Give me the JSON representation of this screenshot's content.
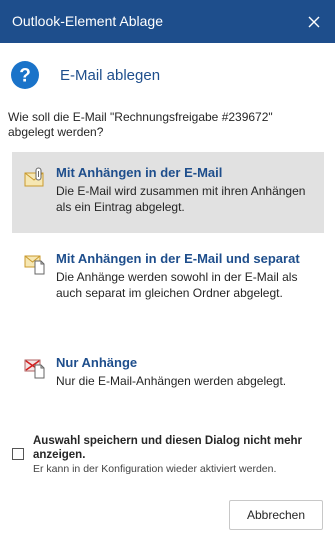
{
  "window": {
    "title": "Outlook-Element Ablage",
    "close_icon": "close-icon"
  },
  "header": {
    "icon": "question-icon",
    "title": "E-Mail ablegen"
  },
  "question": "Wie soll die E-Mail \"Rechnungsfreigabe #239672\" abgelegt werden?",
  "options": [
    {
      "icon": "mail-attachment-icon",
      "title": "Mit Anhängen in der E-Mail",
      "description": "Die E-Mail wird zusammen mit ihren Anhängen als ein Eintrag abgelegt.",
      "selected": true
    },
    {
      "icon": "mail-separate-attachments-icon",
      "title": "Mit Anhängen in der E-Mail und separat",
      "description": "Die Anhänge werden sowohl in der E-Mail als auch separat im gleichen Ordner abgelegt.",
      "selected": false
    },
    {
      "icon": "attachments-only-icon",
      "title": "Nur Anhänge",
      "description": "Nur die E-Mail-Anhängen werden abgelegt.",
      "selected": false
    }
  ],
  "remember": {
    "label": "Auswahl speichern und diesen Dialog nicht mehr anzeigen.",
    "hint": "Er kann in der Konfiguration wieder aktiviert werden.",
    "checked": false
  },
  "buttons": {
    "cancel": "Abbrechen"
  },
  "colors": {
    "titlebar": "#1e4e8c",
    "accent": "#1e4e8c",
    "selected_bg": "#e1e1e1"
  }
}
